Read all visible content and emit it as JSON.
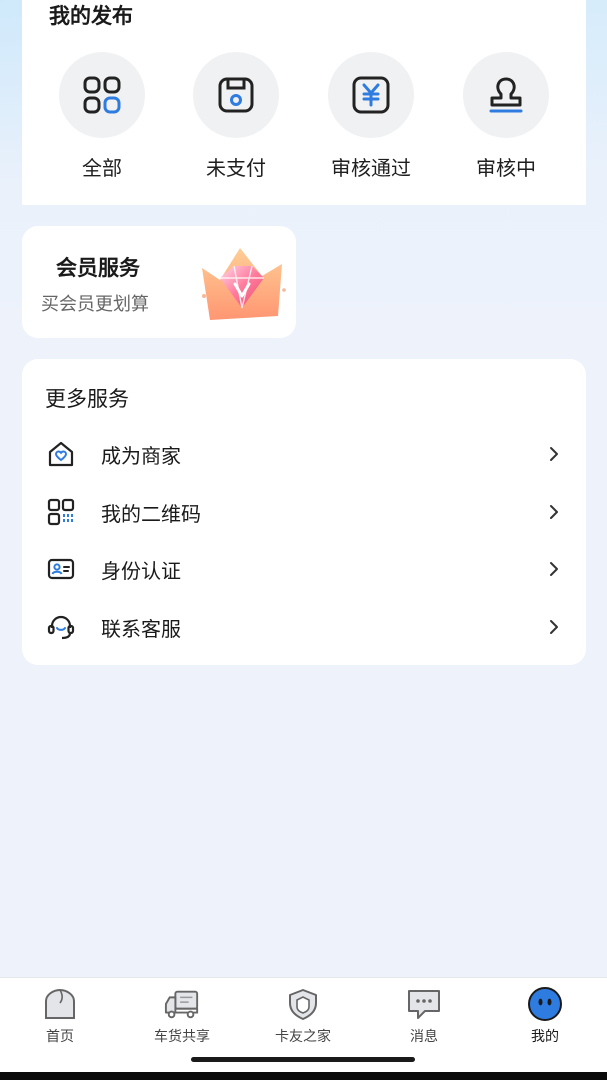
{
  "publish": {
    "title": "我的发布",
    "items": [
      {
        "label": "全部",
        "icon": "grid-icon"
      },
      {
        "label": "未支付",
        "icon": "unpaid-icon"
      },
      {
        "label": "审核通过",
        "icon": "yuan-icon"
      },
      {
        "label": "审核中",
        "icon": "stamp-icon"
      }
    ]
  },
  "member": {
    "title": "会员服务",
    "subtitle": "买会员更划算",
    "icon": "diamond-crown-icon"
  },
  "services": {
    "title": "更多服务",
    "items": [
      {
        "label": "成为商家",
        "icon": "store-heart-icon"
      },
      {
        "label": "我的二维码",
        "icon": "qr-code-icon"
      },
      {
        "label": "身份认证",
        "icon": "id-card-icon"
      },
      {
        "label": "联系客服",
        "icon": "headset-icon"
      }
    ]
  },
  "nav": {
    "items": [
      {
        "label": "首页",
        "icon": "home-icon"
      },
      {
        "label": "车货共享",
        "icon": "truck-icon"
      },
      {
        "label": "卡友之家",
        "icon": "shield-icon"
      },
      {
        "label": "消息",
        "icon": "message-icon"
      },
      {
        "label": "我的",
        "icon": "profile-face-icon",
        "active": true
      }
    ]
  },
  "colors": {
    "accent": "#2f7ce0",
    "background": "#eef2fb",
    "card": "#ffffff"
  }
}
